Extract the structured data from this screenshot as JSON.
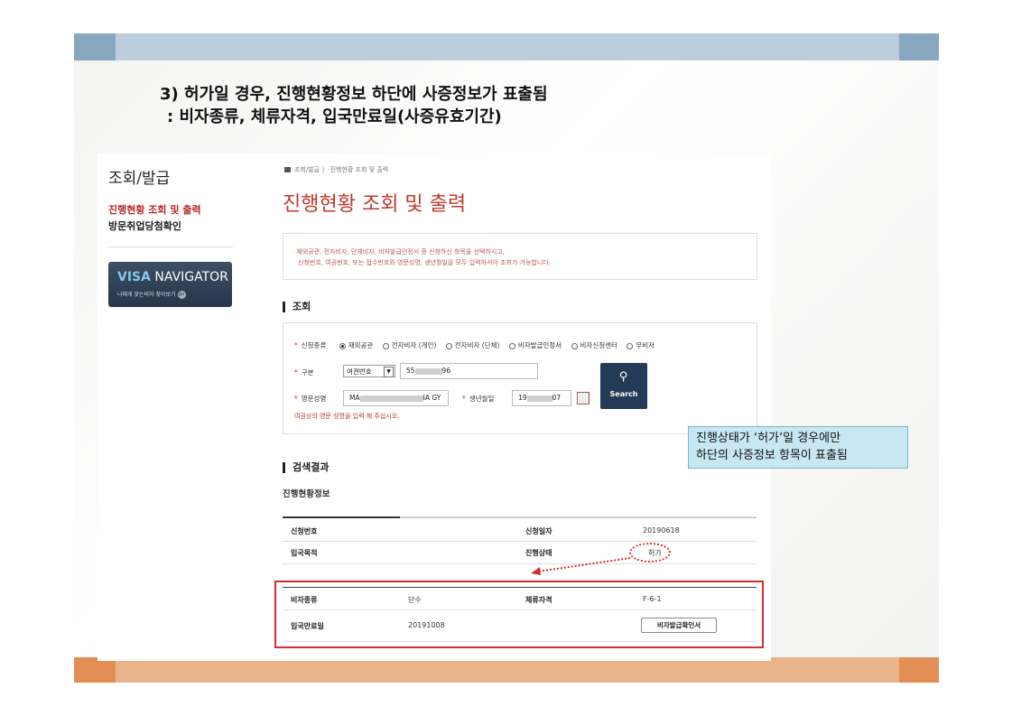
{
  "slide": {
    "title_line1": "3) 허가일 경우, 진행현황정보 하단에 사증정보가 표출됨",
    "title_line2": ": 비자종류, 체류자격, 입국만료일(사증유효기간)",
    "callout_line1": "진행상태가 ‘허가’일 경우에만",
    "callout_line2": "하단의 사증정보 항목이 표출됨",
    "colors": {
      "band_blue": "#8aa7c0",
      "band_orange": "#e38e55",
      "highlight_red": "#d12f2f",
      "callout_bg": "#c7e7f3"
    }
  },
  "sidebar": {
    "title": "조회/발급",
    "items": [
      {
        "label": "진행현황 조회 및 출력",
        "active": true
      },
      {
        "label": "방문취업당첨확인",
        "active": false
      }
    ],
    "banner": {
      "bold": "VISA",
      "rest": " NAVIGATOR",
      "sub": "나에게 맞는비자 찾아보기",
      "go": "go"
    }
  },
  "breadcrumb": {
    "icon": "home-icon",
    "text": "조회/발급 〉 진행현황 조회 및 출력"
  },
  "page": {
    "title": "진행현황 조회 및 출력",
    "notice_line1": "· 재외공관, 전자비자, 단체비자, 비자발급인정서 중 신청하신 항목을 선택하시고,",
    "notice_line2": "신청번호, 여권번호, 또는 접수번호와 영문성명, 생년월일을 모두 입력하셔야 조회가 가능합니다."
  },
  "search": {
    "section_title": "조회",
    "type_label": "신청종류",
    "type_options": [
      "재외공관",
      "전자비자 (개인)",
      "전자비자 (단체)",
      "비자발급인정서",
      "비자신청센터",
      "무비자"
    ],
    "type_selected": "재외공관",
    "division_label": "구분",
    "division_value": "여권번호",
    "division_input_start": "55",
    "division_input_end": "96",
    "name_label": "영문성명",
    "name_input_start": "MA",
    "name_input_end": "IA GY",
    "birth_label": "생년월일",
    "birth_input_start": "19",
    "birth_input_end": "07",
    "hint": "여권상의 영문 성명을 입력 해 주십시오.",
    "button_label": "Search",
    "required_mark": "*"
  },
  "result": {
    "section_title": "검색결과",
    "subtitle": "진행현황정보",
    "rows": [
      {
        "k1": "신청번호",
        "v1": "",
        "k2": "신청일자",
        "v2": "20190618"
      },
      {
        "k1": "입국목적",
        "v1": "",
        "k2": "진행상태",
        "v2": "허가"
      }
    ],
    "visa_rows": [
      {
        "k1": "비자종류",
        "v1": "단수",
        "k2": "체류자격",
        "v2": "F-6-1"
      },
      {
        "k1": "입국만료일",
        "v1": "20191008",
        "k2": "",
        "v2": ""
      }
    ],
    "confirm_button": "비자발급확인서"
  }
}
